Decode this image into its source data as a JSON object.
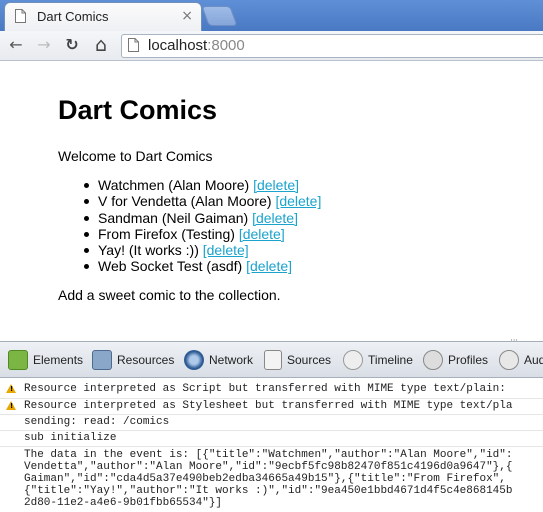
{
  "browser": {
    "tab_title": "Dart Comics",
    "close_glyph": "×",
    "url_host": "localhost",
    "url_port": ":8000",
    "icons": [
      "page-icon",
      "back-icon",
      "forward-icon",
      "reload-icon",
      "home-icon"
    ],
    "back_glyph": "←",
    "forward_glyph": "→",
    "reload_glyph": "↻",
    "home_glyph": "⌂"
  },
  "page": {
    "heading": "Dart Comics",
    "welcome": "Welcome to Dart Comics",
    "delete_label": "[delete]",
    "comics": [
      "Watchmen (Alan Moore)",
      "V for Vendetta (Alan Moore)",
      "Sandman (Neil Gaiman)",
      "From Firefox (Testing)",
      "Yay! (It works :))",
      "Web Socket Test (asdf)"
    ],
    "add_text": "Add a sweet comic to the collection."
  },
  "devtools": {
    "resize_glyph": "|||",
    "tabs": [
      "Elements",
      "Resources",
      "Network",
      "Sources",
      "Timeline",
      "Profiles",
      "Aud"
    ],
    "console": {
      "warnings": [
        "Resource interpreted as Script but transferred with MIME type text/plain:",
        "Resource interpreted as Stylesheet but transferred with MIME type text/pla"
      ],
      "messages": [
        "sending: read: /comics",
        "sub initialize"
      ],
      "data_lines": [
        "The data in the event is: [{\"title\":\"Watchmen\",\"author\":\"Alan Moore\",\"id\":",
        "Vendetta\",\"author\":\"Alan Moore\",\"id\":\"9ecbf5fc98b82470f851c4196d0a9647\"},{",
        "Gaiman\",\"id\":\"cda4d5a37e490beb2edba34665a49b15\"},{\"title\":\"From Firefox\",",
        "{\"title\":\"Yay!\",\"author\":\"It works :)\",\"id\":\"9ea450e1bbd4671d4f5c4e868145b",
        "2d80-11e2-a4e6-9b01fbb65534\"}]"
      ]
    }
  },
  "colors": {
    "link": "#1aa3cc",
    "warning": "#e8a800",
    "tabstrip": "#4a79c4"
  }
}
